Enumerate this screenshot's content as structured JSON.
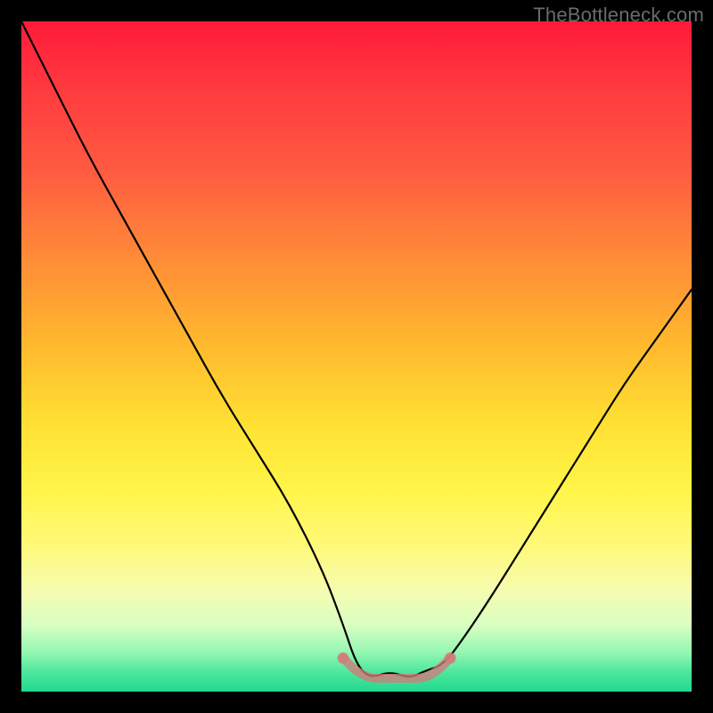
{
  "watermark": {
    "text": "TheBottleneck.com"
  },
  "chart_data": {
    "type": "line",
    "title": "",
    "xlabel": "",
    "ylabel": "",
    "xlim": [
      0,
      100
    ],
    "ylim": [
      0,
      100
    ],
    "grid": false,
    "legend": false,
    "background_gradient": {
      "from": "#ff1a3a",
      "to": "#1fd98e",
      "direction": "top-to-bottom",
      "stops": [
        "#ff1a3a",
        "#ff8a38",
        "#ffe033",
        "#fff978",
        "#97f7b3",
        "#1fd98e"
      ]
    },
    "series": [
      {
        "name": "bottleneck-curve",
        "color": "#000000",
        "x": [
          0,
          5,
          10,
          15,
          20,
          25,
          30,
          35,
          40,
          45,
          48,
          50,
          52,
          55,
          58,
          60,
          63,
          66,
          70,
          75,
          80,
          85,
          90,
          95,
          100
        ],
        "values": [
          100,
          90,
          80,
          71,
          62,
          53,
          44,
          36,
          28,
          18,
          10,
          4,
          2,
          3,
          2,
          3,
          4,
          8,
          14,
          22,
          30,
          38,
          46,
          53,
          60
        ]
      },
      {
        "name": "optimal-band-marker",
        "color": "#d37a7a",
        "x": [
          48,
          50,
          52,
          54,
          56,
          58,
          60,
          62,
          64
        ],
        "values": [
          5,
          3,
          2,
          2,
          2,
          2,
          2,
          3,
          5
        ]
      }
    ],
    "annotations": []
  }
}
